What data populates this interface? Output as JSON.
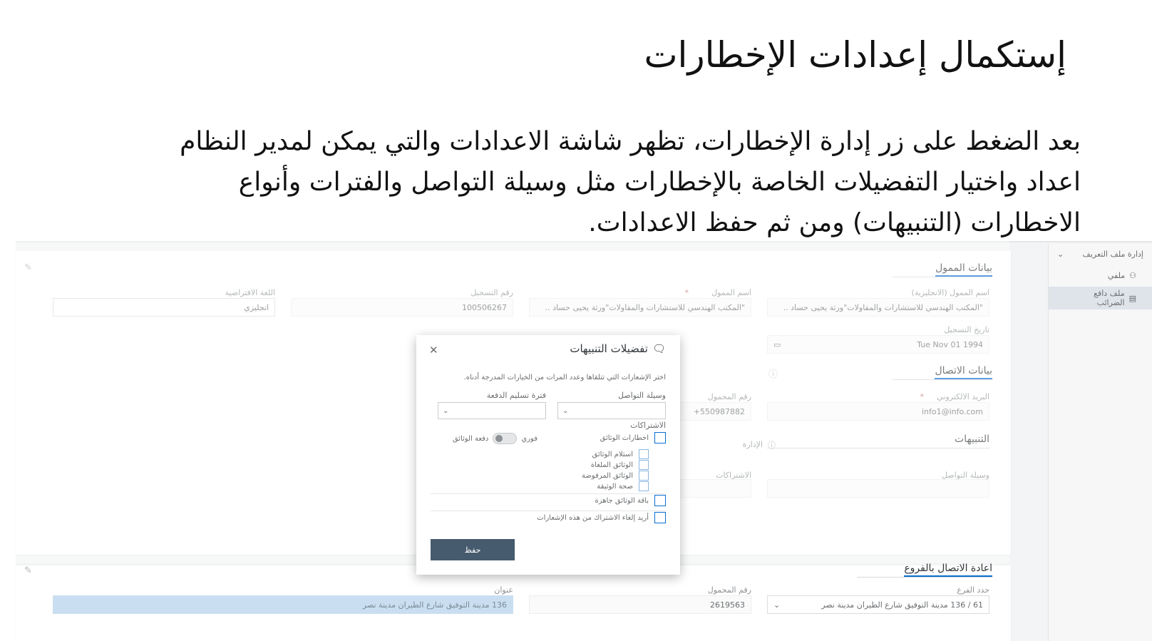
{
  "slide": {
    "title": "إستكمال إعدادات الإخطارات",
    "body": "بعد الضغط على زر إدارة الإخطارات، تظهر شاشة الاعدادات والتي يمكن لمدير النظام اعداد واختيار التفضيلات الخاصة بالإخطارات مثل وسيلة التواصل والفترات وأنواع الاخطارات (التنبيهات) ومن ثم حفظ الاعدادات."
  },
  "nav": {
    "header": "إدارة ملف التعريف",
    "items": [
      {
        "label": "ملفي",
        "icon": "user-icon"
      },
      {
        "label": "ملف دافع الضرائب",
        "icon": "document-icon"
      }
    ]
  },
  "taxpayer": {
    "section_title": "بيانات الممول",
    "name_en_label": "اسم الممول (الانجليزية)",
    "name_en_value": "\"المكتب الهندسي للاستشارات والمقاولات\"ورثة يحيى حساد ..",
    "name_label": "اسم الممول",
    "name_value": "\"المكتب الهندسي للاستشارات والمقاولات\"ورثة يحيى حساد ..",
    "reg_no_label": "رقم التسجيل",
    "reg_no_value": "100506267",
    "lang_label": "اللغة الافتراضية",
    "lang_value": "انجليزي",
    "reg_date_label": "تاريخ التسجيل",
    "reg_date_value": "Tue Nov 01 1994"
  },
  "contact": {
    "section_title": "بيانات الاتصال",
    "email_label": "البريد الالكتروني",
    "email_value": "info1@info.com",
    "mobile_label": "رقم المحمول",
    "mobile_value": "550987882+"
  },
  "alerts": {
    "section_title": "التنبيهات",
    "mgmt_label": "الإدارة",
    "channel_label": "وسيلة التواصل",
    "subs_label": "الاشتراكات"
  },
  "branches": {
    "section_title": "اعادة الاتصال بالفروع",
    "branch_label": "حدد الفرع",
    "branch_value": "61 / 136 مدينة التوفيق شارع الطيران مدينة نصر",
    "mobile_label": "رقم المحمول",
    "mobile_value": "2619563",
    "address_label": "عنوان",
    "address_value": "136 مدينة التوفيق شارع الطيران مدينة نصر"
  },
  "dialog": {
    "title": "تفضيلات التنبيهات",
    "description": "اختر الإشعارات التي تتلقاها وعدد المرات من الخيارات المدرجة أدناه.",
    "channel_label": "وسيلة التواصل",
    "period_label": "فترة تسليم الدفعة",
    "subs_label": "الاشتراكات",
    "doc_alerts": "اخطارات الوثائق",
    "toggle_on": "فوري",
    "toggle_off": "دفعة الوثائق",
    "sub_items": [
      "استلام الوثائق",
      "الوثائق الملغاة",
      "الوثائق المرفوضة",
      "صحة الوثيقة"
    ],
    "ready_docs": "باقة الوثائق جاهزة",
    "unsubscribe": "أريد إلغاء الاشتراك من هذه الإشعارات",
    "save": "حفظ"
  },
  "colors": {
    "accent": "#0a6ed1",
    "save_button": "#475b6e",
    "address_highlight": "#c9dff1"
  }
}
